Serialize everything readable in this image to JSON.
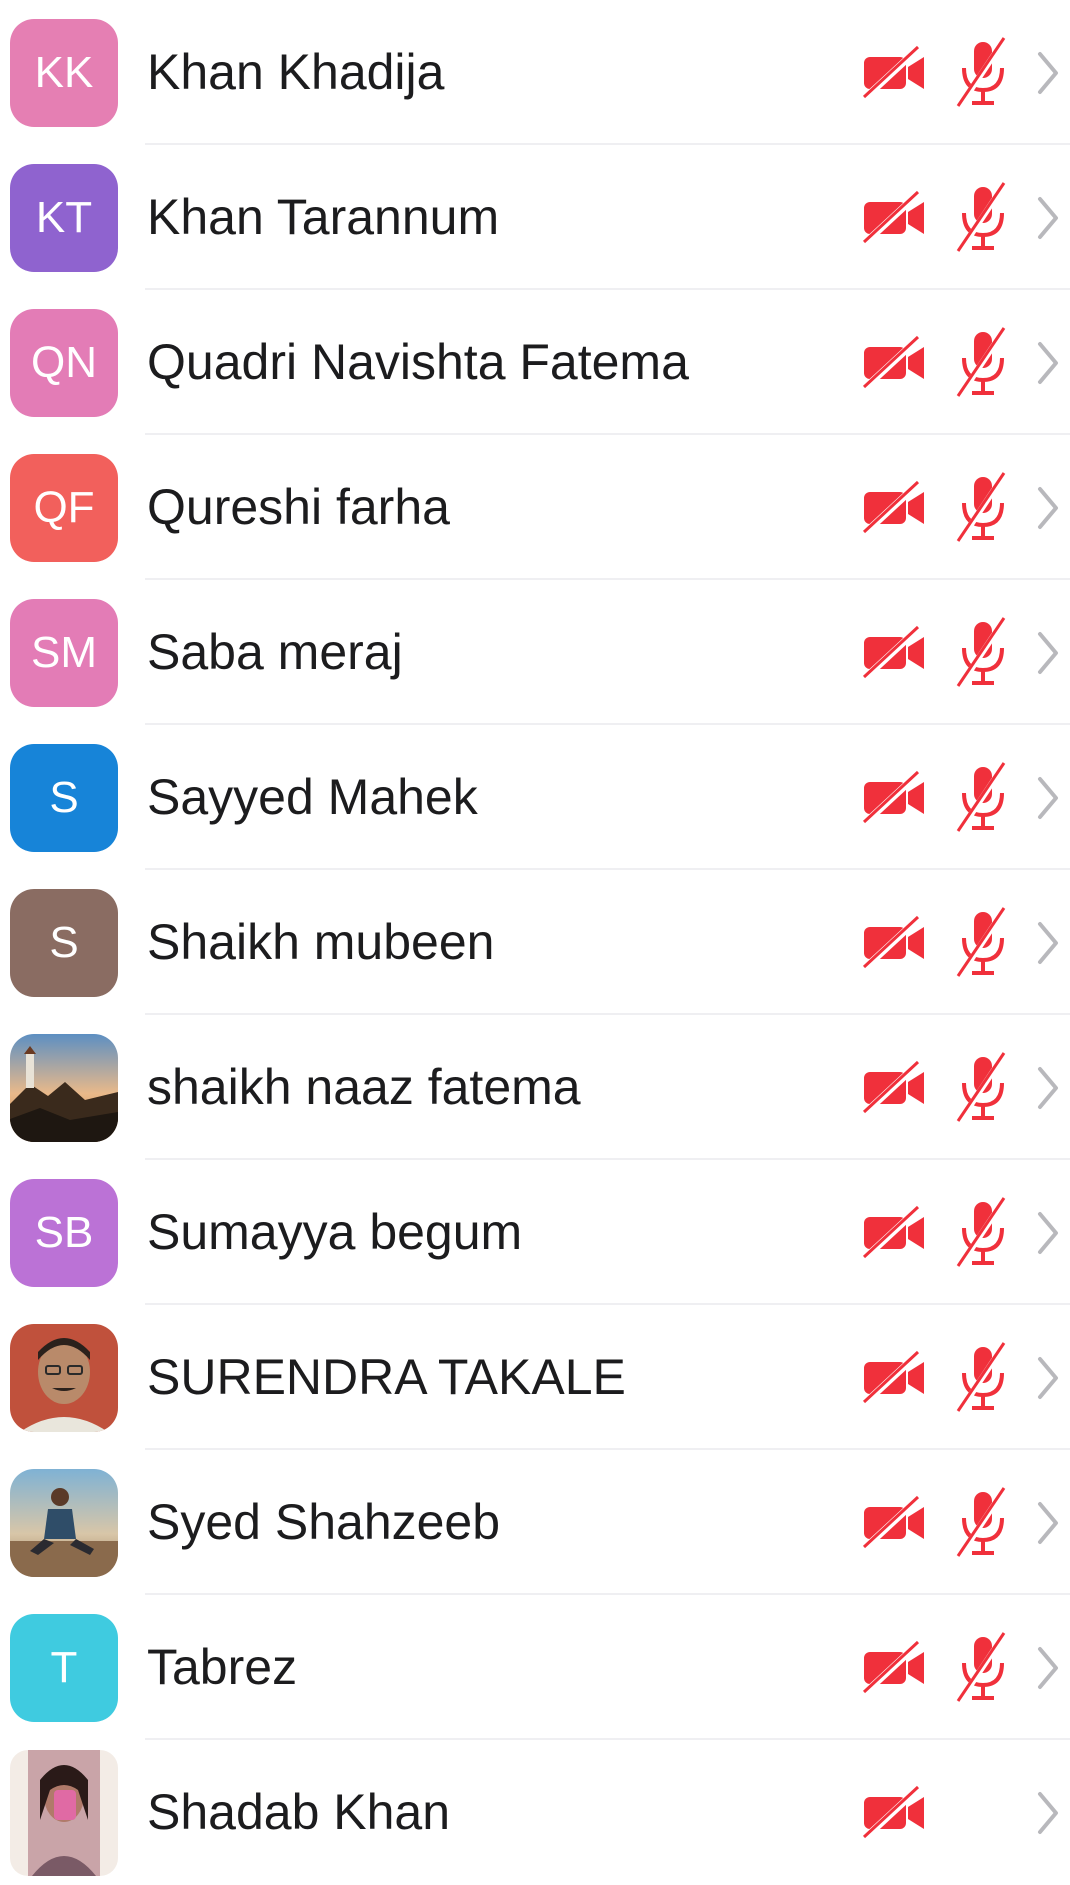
{
  "participants": [
    {
      "initials": "KK",
      "name": "Khan Khadija",
      "avatar_color": "#e57fb3",
      "video_muted": true,
      "audio_muted": true
    },
    {
      "initials": "KT",
      "name": "Khan Tarannum",
      "avatar_color": "#8f63cf",
      "video_muted": true,
      "audio_muted": true
    },
    {
      "initials": "QN",
      "name": "Quadri Navishta Fatema",
      "avatar_color": "#e37cb6",
      "video_muted": true,
      "audio_muted": true
    },
    {
      "initials": "QF",
      "name": "Qureshi farha",
      "avatar_color": "#f2605c",
      "video_muted": true,
      "audio_muted": true
    },
    {
      "initials": "SM",
      "name": "Saba meraj",
      "avatar_color": "#e37cb6",
      "video_muted": true,
      "audio_muted": true
    },
    {
      "initials": "S",
      "name": "Sayyed Mahek",
      "avatar_color": "#1784d8",
      "video_muted": true,
      "audio_muted": true
    },
    {
      "initials": "S",
      "name": "Shaikh mubeen",
      "avatar_color": "#8a6c62",
      "video_muted": true,
      "audio_muted": true
    },
    {
      "initials": "",
      "name": "shaikh naaz fatema",
      "avatar_photo": "landscape-lighthouse",
      "video_muted": true,
      "audio_muted": true
    },
    {
      "initials": "SB",
      "name": "Sumayya begum",
      "avatar_color": "#bb72d6",
      "video_muted": true,
      "audio_muted": true
    },
    {
      "initials": "",
      "name": "SURENDRA TAKALE",
      "avatar_photo": "portrait-man-red-background",
      "video_muted": true,
      "audio_muted": true
    },
    {
      "initials": "",
      "name": "Syed Shahzeeb",
      "avatar_photo": "man-sitting-outdoors",
      "video_muted": true,
      "audio_muted": true
    },
    {
      "initials": "T",
      "name": "Tabrez",
      "avatar_color": "#3fcbe0",
      "video_muted": true,
      "audio_muted": true
    },
    {
      "initials": "",
      "name": "Shadab Khan",
      "avatar_photo": "selfie-person",
      "video_muted": true,
      "audio_muted": false
    }
  ],
  "icons": {
    "video": "video-off-icon",
    "mic": "mic-off-icon",
    "chevron": "chevron-right-icon"
  },
  "colors": {
    "muted_red": "#f0303b",
    "chevron_gray": "#b8b8bc",
    "name_text": "#1c1c1e",
    "divider": "#efeff2"
  }
}
